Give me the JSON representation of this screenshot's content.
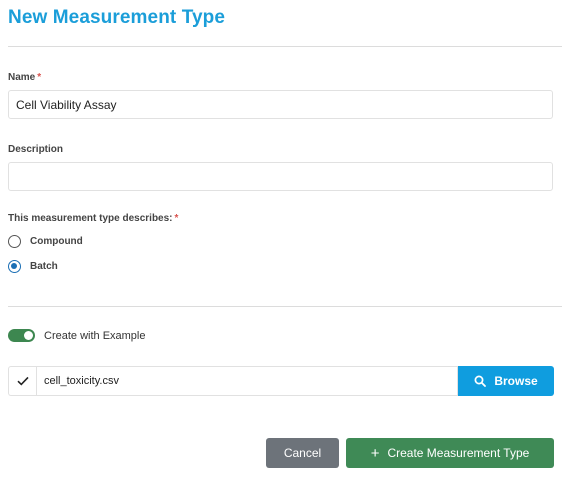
{
  "header": {
    "title": "New Measurement Type"
  },
  "form": {
    "name": {
      "label": "Name",
      "required_mark": "*",
      "value": "Cell Viability Assay"
    },
    "description": {
      "label": "Description",
      "value": ""
    },
    "describes": {
      "label": "This measurement type describes:",
      "required_mark": "*",
      "options": [
        {
          "label": "Compound",
          "checked": false
        },
        {
          "label": "Batch",
          "checked": true
        }
      ]
    },
    "example": {
      "toggle_label": "Create with Example",
      "toggle_on": true,
      "file_name": "cell_toxicity.csv",
      "browse_label": "Browse"
    }
  },
  "actions": {
    "cancel_label": "Cancel",
    "create_label": "Create Measurement Type"
  },
  "colors": {
    "title": "#1b9ed9",
    "browse": "#0f9ddf",
    "create": "#3f8a56",
    "cancel": "#6d737a",
    "toggle": "#3d8750"
  }
}
